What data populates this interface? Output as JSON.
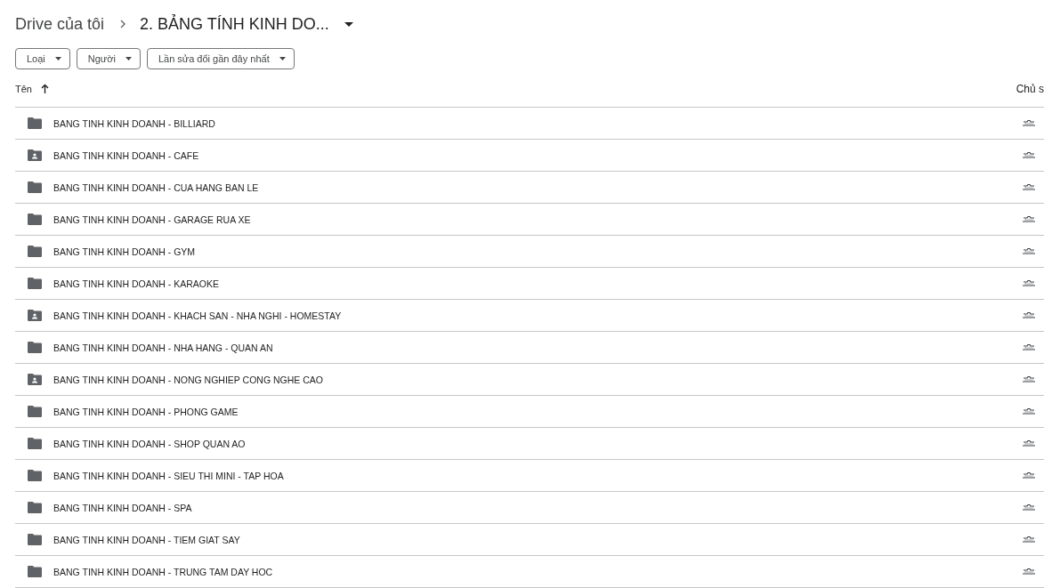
{
  "breadcrumb": [
    {
      "label": "Drive của tôi"
    },
    {
      "label": "2. BẢNG TÍNH KINH DO..."
    }
  ],
  "filters": [
    {
      "label": "Loại"
    },
    {
      "label": "Người"
    },
    {
      "label": "Lần sửa đổi gần đây nhất"
    }
  ],
  "table": {
    "columns": [
      {
        "label": "Tên",
        "sorted": true
      },
      {
        "label": "Chủ s",
        "sorted": false
      }
    ],
    "rows": [
      {
        "kind": "folder",
        "name": "BANG TINH KINH DOANH - BILLIARD"
      },
      {
        "kind": "shared",
        "name": "BANG TINH KINH DOANH - CAFE"
      },
      {
        "kind": "folder",
        "name": "BANG TINH KINH DOANH - CUA HANG BAN LE"
      },
      {
        "kind": "folder",
        "name": "BANG TINH KINH DOANH - GARAGE RUA XE"
      },
      {
        "kind": "folder",
        "name": "BANG TINH KINH DOANH - GYM"
      },
      {
        "kind": "folder",
        "name": "BANG TINH KINH DOANH - KARAOKE"
      },
      {
        "kind": "shared",
        "name": "BANG TINH KINH DOANH - KHACH SAN - NHA NGHI - HOMESTAY"
      },
      {
        "kind": "folder",
        "name": "BANG TINH KINH DOANH - NHA HANG - QUAN AN"
      },
      {
        "kind": "shared",
        "name": "BANG TINH KINH DOANH - NONG NGHIEP CONG NGHE CAO"
      },
      {
        "kind": "folder",
        "name": "BANG TINH KINH DOANH - PHONG GAME"
      },
      {
        "kind": "folder",
        "name": "BANG TINH KINH DOANH - SHOP QUAN AO"
      },
      {
        "kind": "folder",
        "name": "BANG TINH KINH DOANH - SIEU THI MINI - TAP HOA"
      },
      {
        "kind": "folder",
        "name": "BANG TINH KINH DOANH - SPA"
      },
      {
        "kind": "folder",
        "name": "BANG TINH KINH DOANH - TIEM GIAT SAY"
      },
      {
        "kind": "folder",
        "name": "BANG TINH KINH DOANH - TRUNG TAM DAY HOC"
      }
    ]
  }
}
